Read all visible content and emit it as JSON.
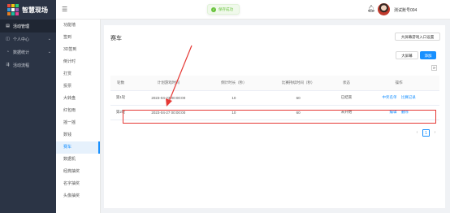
{
  "brand": {
    "name": "智慧现场",
    "logo_colors": [
      "#e74c3c",
      "#f1c40f",
      "#2ecc71",
      "#3498db",
      "#ffffff",
      "#9b59b6",
      "#e67e22",
      "#1abc9c",
      "#e84393"
    ]
  },
  "sidebar": {
    "items": [
      {
        "icon": "clipboard-icon",
        "label": "活动管理",
        "active": true
      },
      {
        "icon": "user-icon",
        "label": "个人中心",
        "caret": "⌄"
      },
      {
        "icon": "chart-icon",
        "label": "数据统计",
        "caret": "⌄"
      },
      {
        "icon": "flow-icon",
        "label": "活动流程"
      }
    ]
  },
  "submenu": {
    "items": [
      "功能墙",
      "签到",
      "3D签到",
      "倒计时",
      "打赏",
      "投票",
      "大转盘",
      "红包雨",
      "摇一摇",
      "数钱",
      "赛车",
      "数据机",
      "经典抽奖",
      "名字抽奖",
      "头像抽奖"
    ],
    "active_index": 10
  },
  "header": {
    "menu_icon": "☰",
    "toast": "保存成功",
    "bell_icon": "bell-icon",
    "user_name": "测试账号004"
  },
  "page": {
    "title": "赛车",
    "entry_button": "大屏幕游戏入口设置",
    "screen_button": "大屏幕",
    "add_button": "添加",
    "refresh_glyph": "⟳"
  },
  "table": {
    "columns": [
      "轮数",
      "计划游戏时间",
      "倒计时长（秒）",
      "比赛持续时间（秒）",
      "状态",
      "操作"
    ],
    "rows": [
      {
        "round": "第1轮",
        "time": "2023-04-23 00:00:00",
        "countdown": "10",
        "duration": "60",
        "status": "已结束",
        "ops": [
          "中奖名单",
          "比赛记录"
        ]
      },
      {
        "round": "第2轮",
        "time": "2023-04-27 00:00:00",
        "countdown": "10",
        "duration": "60",
        "status": "未开始",
        "ops": [
          "编辑",
          "删除"
        ]
      }
    ]
  },
  "pagination": {
    "prev": "‹",
    "current": "1",
    "next": "›"
  },
  "annotation_color": "#e53935",
  "accent_color": "#1890ff"
}
